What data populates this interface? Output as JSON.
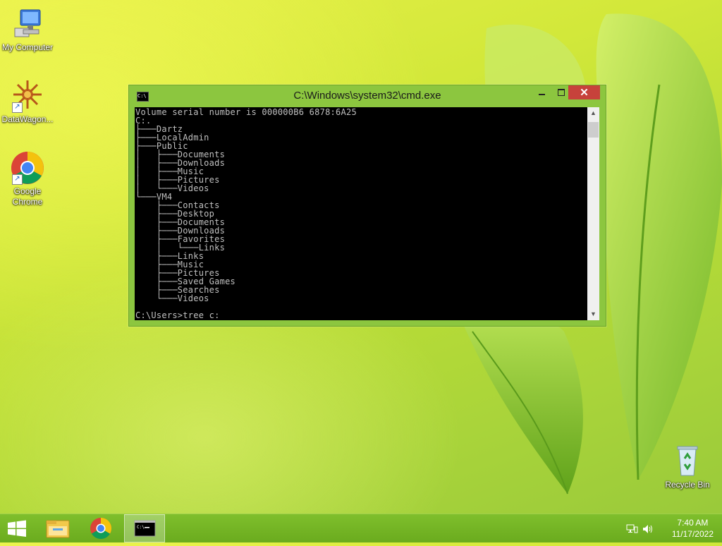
{
  "desktop": {
    "icons": [
      {
        "label": "My Computer"
      },
      {
        "label": "DataWagon..."
      },
      {
        "label": "Google Chrome"
      },
      {
        "label": "Recycle Bin"
      }
    ]
  },
  "cmd_window": {
    "title": "C:\\Windows\\system32\\cmd.exe",
    "console_lines": [
      "Volume serial number is 000000B6 6878:6A25",
      "C:.",
      "├───Dartz",
      "├───LocalAdmin",
      "├───Public",
      "│   ├───Documents",
      "│   ├───Downloads",
      "│   ├───Music",
      "│   ├───Pictures",
      "│   └───Videos",
      "└───VM4",
      "    ├───Contacts",
      "    ├───Desktop",
      "    ├───Documents",
      "    ├───Downloads",
      "    ├───Favorites",
      "    │   └───Links",
      "    ├───Links",
      "    ├───Music",
      "    ├───Pictures",
      "    ├───Saved Games",
      "    ├───Searches",
      "    └───Videos",
      "",
      "C:\\Users>tree c:"
    ],
    "console_colors": {
      "background": "#000000",
      "foreground": "#c0c0c0"
    },
    "frame_color": "#8cc63f",
    "close_color": "#c7423b"
  },
  "taskbar": {
    "items": [
      {
        "icon": "windows-logo-icon"
      },
      {
        "icon": "file-explorer-icon"
      },
      {
        "icon": "chrome-icon"
      },
      {
        "icon": "command-prompt-icon"
      }
    ],
    "tray": {
      "icons": [
        "network-icon",
        "volume-icon"
      ]
    },
    "clock": {
      "time": "7:40 AM",
      "date": "11/17/2022"
    }
  }
}
